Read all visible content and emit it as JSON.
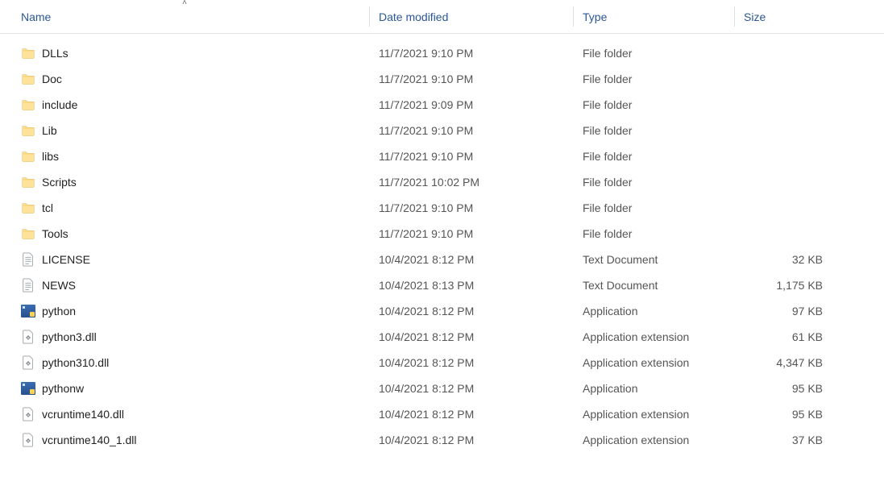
{
  "columns": {
    "name": "Name",
    "date": "Date modified",
    "type": "Type",
    "size": "Size"
  },
  "sort_indicator": "˄",
  "items": [
    {
      "icon": "folder",
      "name": "DLLs",
      "date": "11/7/2021 9:10 PM",
      "type": "File folder",
      "size": ""
    },
    {
      "icon": "folder",
      "name": "Doc",
      "date": "11/7/2021 9:10 PM",
      "type": "File folder",
      "size": ""
    },
    {
      "icon": "folder",
      "name": "include",
      "date": "11/7/2021 9:09 PM",
      "type": "File folder",
      "size": ""
    },
    {
      "icon": "folder",
      "name": "Lib",
      "date": "11/7/2021 9:10 PM",
      "type": "File folder",
      "size": ""
    },
    {
      "icon": "folder",
      "name": "libs",
      "date": "11/7/2021 9:10 PM",
      "type": "File folder",
      "size": ""
    },
    {
      "icon": "folder",
      "name": "Scripts",
      "date": "11/7/2021 10:02 PM",
      "type": "File folder",
      "size": ""
    },
    {
      "icon": "folder",
      "name": "tcl",
      "date": "11/7/2021 9:10 PM",
      "type": "File folder",
      "size": ""
    },
    {
      "icon": "folder",
      "name": "Tools",
      "date": "11/7/2021 9:10 PM",
      "type": "File folder",
      "size": ""
    },
    {
      "icon": "text",
      "name": "LICENSE",
      "date": "10/4/2021 8:12 PM",
      "type": "Text Document",
      "size": "32 KB"
    },
    {
      "icon": "text",
      "name": "NEWS",
      "date": "10/4/2021 8:13 PM",
      "type": "Text Document",
      "size": "1,175 KB"
    },
    {
      "icon": "app",
      "name": "python",
      "date": "10/4/2021 8:12 PM",
      "type": "Application",
      "size": "97 KB"
    },
    {
      "icon": "dll",
      "name": "python3.dll",
      "date": "10/4/2021 8:12 PM",
      "type": "Application extension",
      "size": "61 KB"
    },
    {
      "icon": "dll",
      "name": "python310.dll",
      "date": "10/4/2021 8:12 PM",
      "type": "Application extension",
      "size": "4,347 KB"
    },
    {
      "icon": "app",
      "name": "pythonw",
      "date": "10/4/2021 8:12 PM",
      "type": "Application",
      "size": "95 KB"
    },
    {
      "icon": "dll",
      "name": "vcruntime140.dll",
      "date": "10/4/2021 8:12 PM",
      "type": "Application extension",
      "size": "95 KB"
    },
    {
      "icon": "dll",
      "name": "vcruntime140_1.dll",
      "date": "10/4/2021 8:12 PM",
      "type": "Application extension",
      "size": "37 KB"
    }
  ]
}
